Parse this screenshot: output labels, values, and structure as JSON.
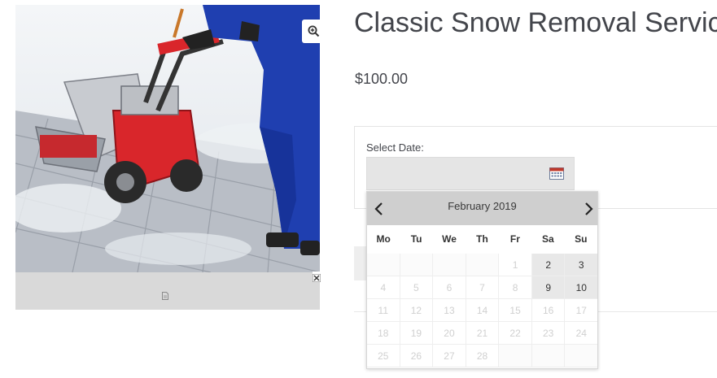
{
  "product": {
    "title": "Classic Snow Removal Service",
    "price": "$100.00"
  },
  "gallery": {
    "image_alt": "Person using red snow blower on snowy path",
    "zoom_icon": "zoom-in-icon",
    "thumbnail_icon": "file-icon"
  },
  "booking": {
    "select_date_label": "Select Date:",
    "date_input_value": "",
    "calendar_icon": "calendar-icon"
  },
  "datepicker": {
    "month_label": "February 2019",
    "prev_icon": "chevron-left-icon",
    "next_icon": "chevron-right-icon",
    "weekdays": [
      "Mo",
      "Tu",
      "We",
      "Th",
      "Fr",
      "Sa",
      "Su"
    ],
    "weeks": [
      [
        "",
        "",
        "",
        "",
        "1",
        "2",
        "3"
      ],
      [
        "4",
        "5",
        "6",
        "7",
        "8",
        "9",
        "10"
      ],
      [
        "11",
        "12",
        "13",
        "14",
        "15",
        "16",
        "17"
      ],
      [
        "18",
        "19",
        "20",
        "21",
        "22",
        "23",
        "24"
      ],
      [
        "25",
        "26",
        "27",
        "28",
        "",
        "",
        ""
      ]
    ],
    "available_days": [
      "2",
      "3",
      "9",
      "10"
    ]
  },
  "colors": {
    "text": "#43454b",
    "snow_blower_red": "#d9262b",
    "jumpsuit_blue": "#1f3fb0"
  }
}
